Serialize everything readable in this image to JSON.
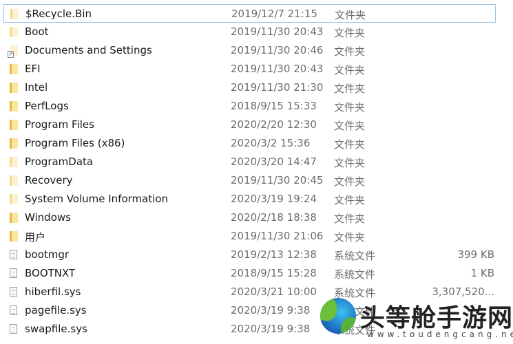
{
  "files": [
    {
      "name": "$Recycle.Bin",
      "date": "2019/12/7 21:15",
      "type": "文件夹",
      "size": "",
      "icon": "folder-light-icon",
      "selected": true
    },
    {
      "name": "Boot",
      "date": "2019/11/30 20:43",
      "type": "文件夹",
      "size": "",
      "icon": "folder-light-icon"
    },
    {
      "name": "Documents and Settings",
      "date": "2019/11/30 20:46",
      "type": "文件夹",
      "size": "",
      "icon": "shortcut-folder-icon"
    },
    {
      "name": "EFI",
      "date": "2019/11/30 20:43",
      "type": "文件夹",
      "size": "",
      "icon": "folder-icon"
    },
    {
      "name": "Intel",
      "date": "2019/11/30 21:30",
      "type": "文件夹",
      "size": "",
      "icon": "folder-icon"
    },
    {
      "name": "PerfLogs",
      "date": "2018/9/15 15:33",
      "type": "文件夹",
      "size": "",
      "icon": "folder-icon"
    },
    {
      "name": "Program Files",
      "date": "2020/2/20 12:30",
      "type": "文件夹",
      "size": "",
      "icon": "folder-icon"
    },
    {
      "name": "Program Files (x86)",
      "date": "2020/3/2 15:36",
      "type": "文件夹",
      "size": "",
      "icon": "folder-icon"
    },
    {
      "name": "ProgramData",
      "date": "2020/3/20 14:47",
      "type": "文件夹",
      "size": "",
      "icon": "folder-light-icon"
    },
    {
      "name": "Recovery",
      "date": "2019/11/30 20:45",
      "type": "文件夹",
      "size": "",
      "icon": "folder-light-icon"
    },
    {
      "name": "System Volume Information",
      "date": "2020/3/19 19:24",
      "type": "文件夹",
      "size": "",
      "icon": "folder-light-icon"
    },
    {
      "name": "Windows",
      "date": "2020/2/18 18:38",
      "type": "文件夹",
      "size": "",
      "icon": "folder-icon"
    },
    {
      "name": "用户",
      "date": "2019/11/30 21:06",
      "type": "文件夹",
      "size": "",
      "icon": "folder-icon"
    },
    {
      "name": "bootmgr",
      "date": "2019/2/13 12:38",
      "type": "系统文件",
      "size": "399 KB",
      "icon": "file-icon"
    },
    {
      "name": "BOOTNXT",
      "date": "2018/9/15 15:28",
      "type": "系统文件",
      "size": "1 KB",
      "icon": "file-icon"
    },
    {
      "name": "hiberfil.sys",
      "date": "2020/3/21 10:00",
      "type": "系统文件",
      "size": "3,307,520...",
      "icon": "file-icon"
    },
    {
      "name": "pagefile.sys",
      "date": "2020/3/19 9:38",
      "type": "系统文件",
      "size": "",
      "icon": "file-icon"
    },
    {
      "name": "swapfile.sys",
      "date": "2020/3/19 9:38",
      "type": "系统文件",
      "size": "",
      "icon": "file-icon"
    }
  ],
  "watermark": {
    "title": "头等舱手游网",
    "url": "www.toudengcang.net"
  }
}
